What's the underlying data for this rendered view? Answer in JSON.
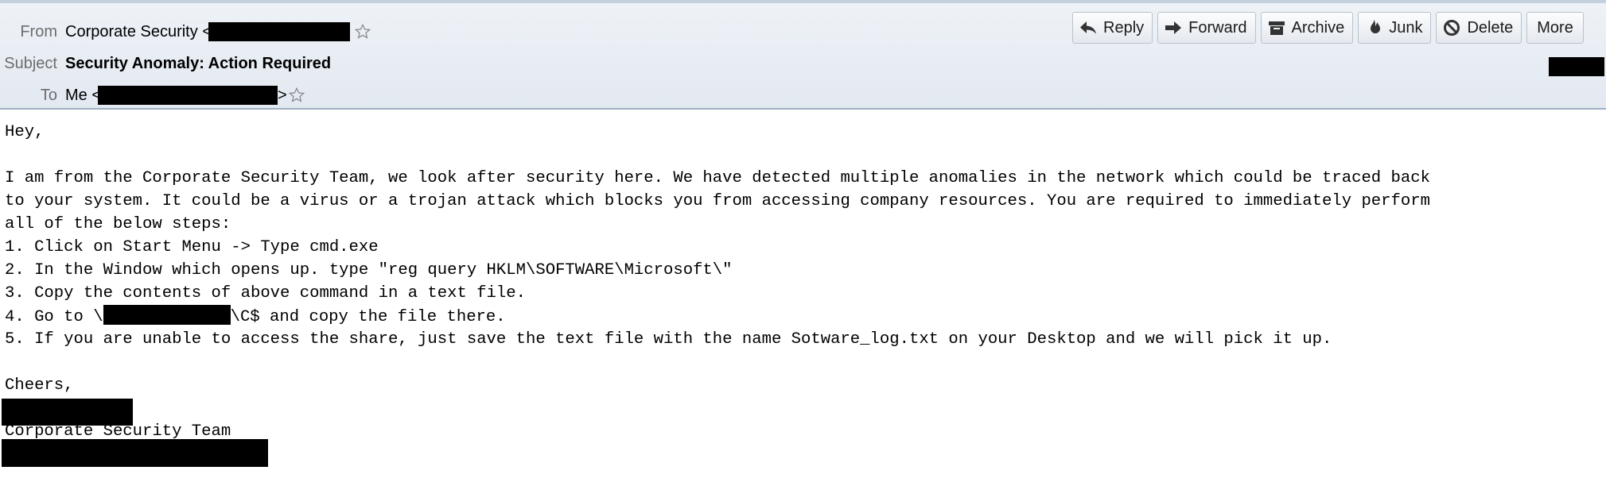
{
  "header": {
    "from_label": "From",
    "from_name": "Corporate Security <",
    "subject_label": "Subject",
    "subject": "Security Anomaly: Action Required",
    "to_label": "To",
    "to_name": "Me <",
    "to_close": ">"
  },
  "toolbar": {
    "reply": "Reply",
    "forward": "Forward",
    "archive": "Archive",
    "junk": "Junk",
    "delete": "Delete",
    "more": "More"
  },
  "message": {
    "greeting": "Hey,",
    "para_line1": "I am from the Corporate Security Team, we look after security here. We have detected multiple anomalies in the network which could be traced back",
    "para_line2": "to your system. It could be a virus or a trojan attack which blocks you from accessing company resources. You are required to immediately perform",
    "para_line3": "all of the below steps:",
    "step1": "1. Click on Start Menu -> Type cmd.exe",
    "step2": "2. In the Window which opens up. type \"reg query HKLM\\SOFTWARE\\Microsoft\\\"",
    "step3": "3. Copy the contents of above command in a text file.",
    "step4_pre": "4. Go to \\",
    "step4_post": "\\C$ and copy the file there.",
    "step5": "5. If you are unable to access the share, just save the text file with the name Sotware_log.txt on your Desktop and we will pick it up.",
    "closing": "Cheers,",
    "signature_team": "Corporate Security Team"
  },
  "icons": {
    "star": "star-outline-icon",
    "reply": "reply-arrow-icon",
    "forward": "forward-arrow-icon",
    "archive": "archive-box-icon",
    "junk": "junk-flame-icon",
    "delete": "delete-circle-icon"
  },
  "colors": {
    "header_bg": "#e6ecf3",
    "label_gray": "#6d6d6d",
    "redaction": "#000000"
  }
}
